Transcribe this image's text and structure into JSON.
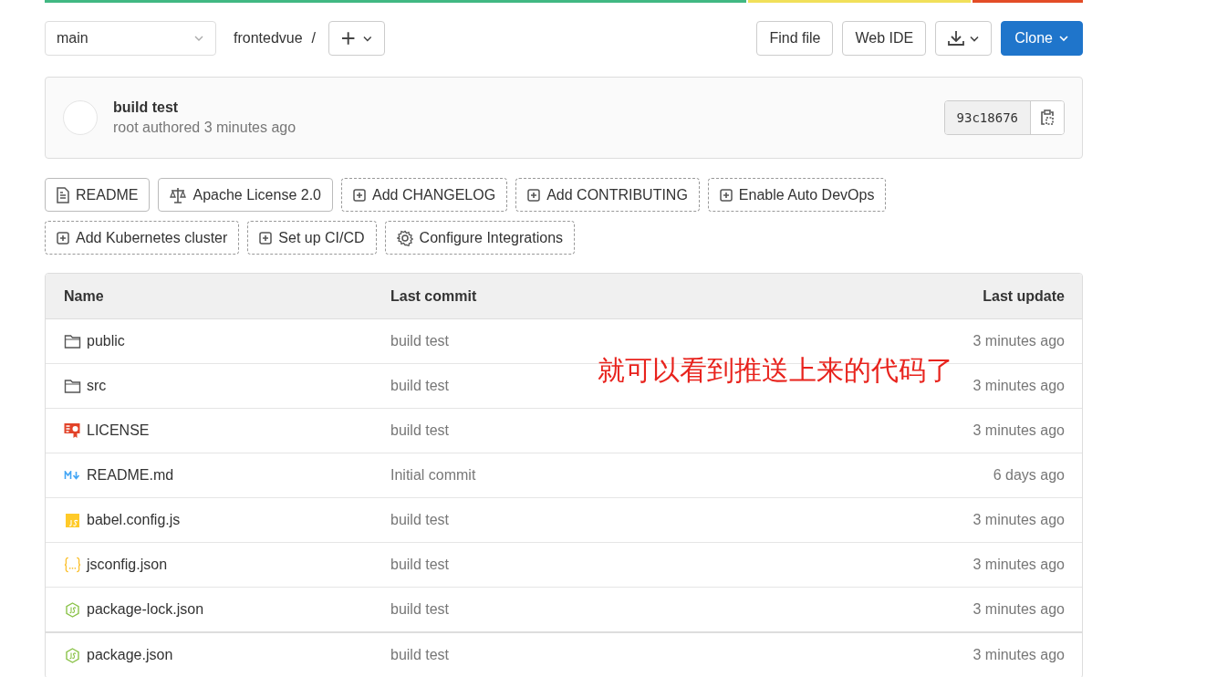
{
  "toolbar": {
    "branch": "main",
    "path": "frontedvue",
    "separator": "/",
    "buttons": [
      {
        "label": "Find file",
        "kind": "plain"
      },
      {
        "label": "Web IDE",
        "kind": "plain"
      },
      {
        "kind": "download"
      },
      {
        "label": "Clone",
        "kind": "primary"
      }
    ]
  },
  "commit": {
    "title": "build test",
    "meta": "root authored 3 minutes ago",
    "sha": "93c18676"
  },
  "badges": [
    {
      "label": "README",
      "kind": "file"
    },
    {
      "label": "Apache License 2.0",
      "kind": "license"
    },
    {
      "label": "Add CHANGELOG",
      "kind": "add"
    },
    {
      "label": "Add CONTRIBUTING",
      "kind": "add"
    },
    {
      "label": "Enable Auto DevOps",
      "kind": "add"
    },
    {
      "label": "Add Kubernetes cluster",
      "kind": "add"
    },
    {
      "label": "Set up CI/CD",
      "kind": "add"
    },
    {
      "label": "Configure Integrations",
      "kind": "settings"
    }
  ],
  "table": {
    "columns": [
      "Name",
      "Last commit",
      "Last update"
    ],
    "rows": [
      {
        "name": "public",
        "kind": "folder",
        "commit": "build test",
        "updated": "3 minutes ago"
      },
      {
        "name": "src",
        "kind": "folder",
        "commit": "build test",
        "updated": "3 minutes ago"
      },
      {
        "name": "LICENSE",
        "kind": "license",
        "commit": "build test",
        "updated": "3 minutes ago"
      },
      {
        "name": "README.md",
        "kind": "markdown",
        "commit": "Initial commit",
        "updated": "6 days ago"
      },
      {
        "name": "babel.config.js",
        "kind": "js",
        "commit": "build test",
        "updated": "3 minutes ago"
      },
      {
        "name": "jsconfig.json",
        "kind": "json",
        "commit": "build test",
        "updated": "3 minutes ago"
      },
      {
        "name": "package-lock.json",
        "kind": "node",
        "commit": "build test",
        "updated": "3 minutes ago"
      },
      {
        "name": "package.json",
        "kind": "node",
        "commit": "build test",
        "updated": "3 minutes ago"
      }
    ]
  },
  "annotation": "就可以看到推送上来的代码了"
}
